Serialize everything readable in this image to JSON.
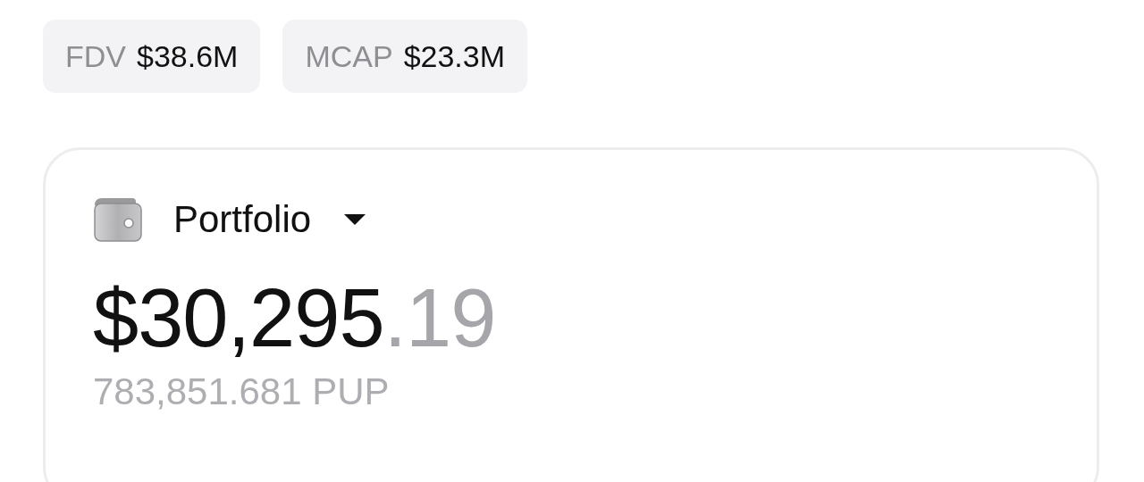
{
  "stats": [
    {
      "label": "FDV",
      "value": "$38.6M"
    },
    {
      "label": "MCAP",
      "value": "$23.3M"
    }
  ],
  "portfolio": {
    "title": "Portfolio",
    "balance_whole": "$30,295",
    "balance_fraction": ".19",
    "token_amount": "783,851.681 PUP"
  }
}
